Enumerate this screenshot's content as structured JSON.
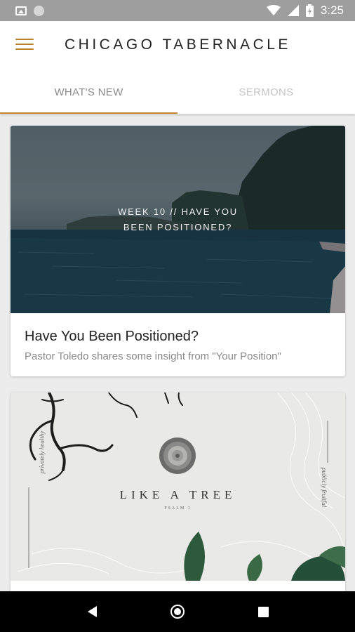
{
  "status_bar": {
    "time": "3:25"
  },
  "app_bar": {
    "title": "CHICAGO TABERNACLE",
    "menu_icon": "menu-icon"
  },
  "tabs": [
    {
      "label": "WHAT'S NEW",
      "active": true
    },
    {
      "label": "SERMONS",
      "active": false
    }
  ],
  "cards": [
    {
      "image_text_line1": "WEEK 10 // HAVE YOU",
      "image_text_line2": "BEEN POSITIONED?",
      "title": "Have You Been Positioned?",
      "subtitle": "Pastor Toledo shares some insight from \"Your Position\""
    },
    {
      "image_title": "LIKE A TREE",
      "image_subtitle": "PSALM 1",
      "side_left": "privately healthy",
      "side_right": "publicly fruitful"
    }
  ],
  "colors": {
    "accent": "#c48a3a",
    "status_bar": "#9e9e9e",
    "nav_bar": "#000000"
  }
}
